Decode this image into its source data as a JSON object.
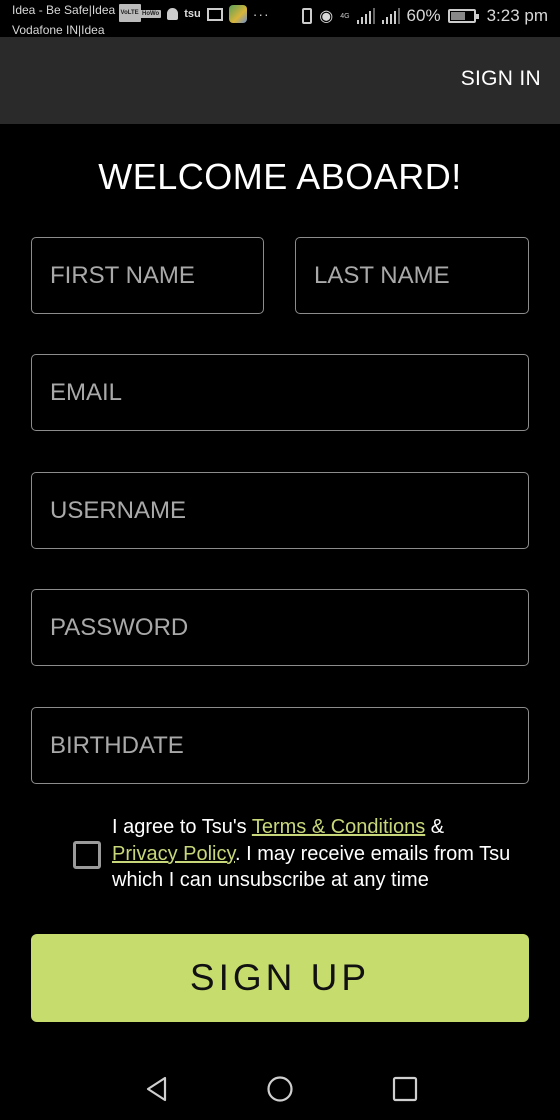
{
  "status_bar": {
    "carrier_line1": "Idea - Be Safe|Idea",
    "carrier_line2": "Vodafone IN|Idea",
    "volte_badge": "VoLTE",
    "hd_badge": "HoWo",
    "tsu_label": "tsu",
    "network_type": "4G",
    "battery_percent": "60%",
    "battery_level": 0.6,
    "time": "3:23 pm",
    "icons": [
      "volte-icon",
      "hd-icon",
      "bell-icon",
      "tsu-icon",
      "mail-icon",
      "maps-icon",
      "more-icon",
      "vibrate-icon",
      "eye-comfort-icon",
      "signal-4g-icon",
      "signal-icon",
      "battery-icon"
    ]
  },
  "app_bar": {
    "sign_in_label": "SIGN IN"
  },
  "form": {
    "title": "WELCOME ABOARD!",
    "fields": {
      "first_name": {
        "placeholder": "FIRST NAME",
        "value": ""
      },
      "last_name": {
        "placeholder": "LAST NAME",
        "value": ""
      },
      "email": {
        "placeholder": "EMAIL",
        "value": ""
      },
      "username": {
        "placeholder": "USERNAME",
        "value": ""
      },
      "password": {
        "placeholder": "PASSWORD",
        "value": ""
      },
      "birthdate": {
        "placeholder": "BIRTHDATE",
        "value": ""
      }
    },
    "agreement": {
      "checked": false,
      "prefix": "I agree to Tsu's ",
      "terms_link": "Terms & Conditions",
      "middle": " & ",
      "privacy_link": "Privacy Policy",
      "suffix": ". I may receive emails from Tsu which I can unsubscribe at any time"
    },
    "sign_up_label": "SIGN UP"
  },
  "colors": {
    "accent": "#c6dc6d",
    "link": "#c7d77a",
    "app_bar_bg": "#2a2a2a",
    "background": "#000000"
  },
  "nav_bar": {
    "buttons": [
      "back-icon",
      "home-icon",
      "recents-icon"
    ]
  }
}
